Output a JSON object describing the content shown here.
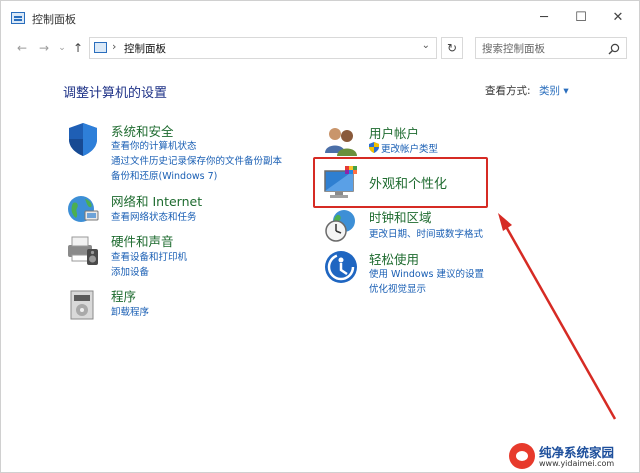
{
  "window": {
    "title": "控制面板",
    "controls": {
      "minimize": "─",
      "maximize": "☐",
      "close": "✕"
    }
  },
  "navigation": {
    "back": "←",
    "forward": "→",
    "recent": "⌄",
    "up": "↑",
    "address": "控制面板",
    "separator": "›",
    "dropdown": "⌄",
    "refresh": "↻",
    "search_placeholder": "搜索控制面板"
  },
  "content": {
    "heading": "调整计算机的设置",
    "view_by_label": "查看方式:",
    "view_by_value": "类别 ▾"
  },
  "categories_left": [
    {
      "title": "系统和安全",
      "icon": "shield-icon",
      "links": [
        "查看你的计算机状态",
        "通过文件历史记录保存你的文件备份副本",
        "备份和还原(Windows 7)"
      ]
    },
    {
      "title": "网络和 Internet",
      "icon": "globe-network-icon",
      "links": [
        "查看网络状态和任务"
      ]
    },
    {
      "title": "硬件和声音",
      "icon": "printer-speaker-icon",
      "links": [
        "查看设备和打印机",
        "添加设备"
      ]
    },
    {
      "title": "程序",
      "icon": "programs-icon",
      "links": [
        "卸载程序"
      ]
    }
  ],
  "categories_right": [
    {
      "title": "用户帐户",
      "icon": "users-icon",
      "links": [
        "更改帐户类型"
      ]
    },
    {
      "title": "外观和个性化",
      "icon": "monitor-palette-icon",
      "links": []
    },
    {
      "title": "时钟和区域",
      "icon": "clock-globe-icon",
      "links": [
        "更改日期、时间或数字格式"
      ]
    },
    {
      "title": "轻松使用",
      "icon": "ease-of-access-icon",
      "links": [
        "使用 Windows 建议的设置",
        "优化视觉显示"
      ]
    }
  ],
  "watermark": {
    "title": "纯净系统家园",
    "url": "www.yidaimei.com"
  },
  "colors": {
    "heading": "#1e3287",
    "category_title": "#1e6b2f",
    "link": "#1a5fb4",
    "highlight": "#d62b24"
  }
}
